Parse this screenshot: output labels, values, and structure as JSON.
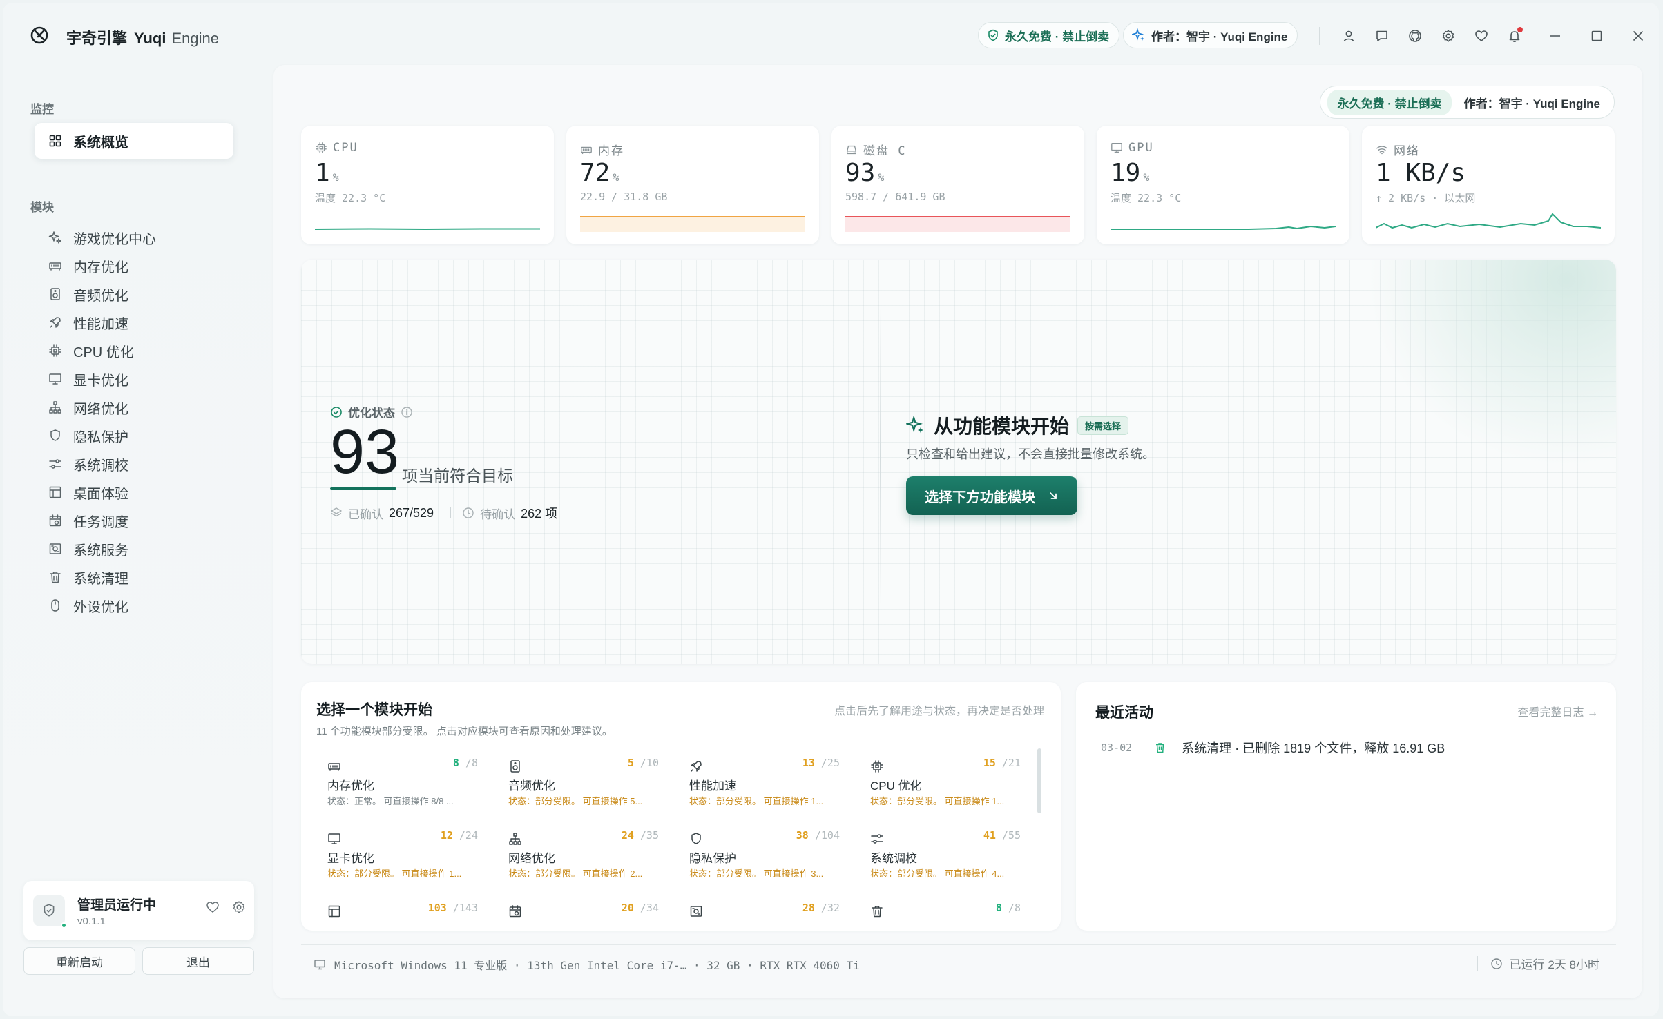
{
  "app": {
    "title_cn": "宇奇引擎",
    "title_en": "Yuqi",
    "title_en2": "Engine"
  },
  "titlebar": {
    "free_pill": "永久免费 · 禁止倒卖",
    "author_pill": "作者：智宇 · Yuqi Engine",
    "icons": [
      "user-icon",
      "message-icon",
      "github-icon",
      "settings-icon",
      "heart-icon",
      "bell-icon"
    ],
    "window_controls": [
      "minimize-icon",
      "maximize-icon",
      "close-icon"
    ]
  },
  "sidebar": {
    "section_monitor": "监控",
    "overview": "系统概览",
    "section_modules": "模块",
    "items": [
      {
        "label": "游戏优化中心",
        "icon": "sparkle-icon"
      },
      {
        "label": "内存优化",
        "icon": "memory-icon"
      },
      {
        "label": "音频优化",
        "icon": "speaker-icon"
      },
      {
        "label": "性能加速",
        "icon": "rocket-icon"
      },
      {
        "label": "CPU 优化",
        "icon": "cpu-icon"
      },
      {
        "label": "显卡优化",
        "icon": "monitor-icon"
      },
      {
        "label": "网络优化",
        "icon": "network-icon"
      },
      {
        "label": "隐私保护",
        "icon": "shield-icon"
      },
      {
        "label": "系统调校",
        "icon": "sliders-icon"
      },
      {
        "label": "桌面体验",
        "icon": "layout-icon"
      },
      {
        "label": "任务调度",
        "icon": "calendar-icon"
      },
      {
        "label": "系统服务",
        "icon": "services-icon"
      },
      {
        "label": "系统清理",
        "icon": "trash-icon"
      },
      {
        "label": "外设优化",
        "icon": "mouse-icon"
      }
    ],
    "admin": {
      "title": "管理员运行中",
      "version": "v0.1.1"
    },
    "restart_btn": "重新启动",
    "exit_btn": "退出"
  },
  "main": {
    "free_tag": "永久免费 · 禁止倒卖",
    "author": "作者：智宇 · Yuqi Engine"
  },
  "stats": [
    {
      "label": "CPU",
      "value": "1",
      "unit": "%",
      "sub": "温度 22.3 °C",
      "color": "#2fa985"
    },
    {
      "label": "内存",
      "value": "72",
      "unit": "%",
      "sub": "22.9 / 31.8 GB",
      "color": "#f0a544"
    },
    {
      "label": "磁盘 C",
      "value": "93",
      "unit": "%",
      "sub": "598.7 / 641.9 GB",
      "color": "#e8555a"
    },
    {
      "label": "GPU",
      "value": "19",
      "unit": "%",
      "sub": "温度 22.3 °C",
      "color": "#2fa985"
    },
    {
      "label": "网络",
      "value": "1 KB/s",
      "unit": "",
      "sub": "↑ 2 KB/s · 以太网",
      "color": "#2fa985"
    }
  ],
  "hero": {
    "status_label": "优化状态",
    "score": "93",
    "score_text": "项当前符合目标",
    "confirmed_label": "已确认",
    "confirmed_value": "267/529",
    "pending_label": "待确认",
    "pending_value": "262 项",
    "right_title": "从功能模块开始",
    "right_badge": "按需选择",
    "right_desc": "只检查和给出建议，不会直接批量修改系统。",
    "button": "选择下方功能模块"
  },
  "modules": {
    "title": "选择一个模块开始",
    "hint": "点击后先了解用途与状态，再决定是否处理",
    "subtitle": "11 个功能模块部分受限。 点击对应模块可查看原因和处理建议。",
    "items": [
      {
        "name": "内存优化",
        "icon": "memory-icon",
        "done": "8",
        "total": "/8",
        "state": "状态：正常。 可直接操作 8/8 ...",
        "ok": true
      },
      {
        "name": "音频优化",
        "icon": "speaker-icon",
        "done": "5",
        "total": "/10",
        "state": "状态：部分受限。 可直接操作 5...",
        "ok": false
      },
      {
        "name": "性能加速",
        "icon": "rocket-icon",
        "done": "13",
        "total": "/25",
        "state": "状态：部分受限。 可直接操作 1...",
        "ok": false
      },
      {
        "name": "CPU 优化",
        "icon": "cpu-icon",
        "done": "15",
        "total": "/21",
        "state": "状态：部分受限。 可直接操作 1...",
        "ok": false
      },
      {
        "name": "显卡优化",
        "icon": "monitor-icon",
        "done": "12",
        "total": "/24",
        "state": "状态：部分受限。 可直接操作 1...",
        "ok": false
      },
      {
        "name": "网络优化",
        "icon": "network-icon",
        "done": "24",
        "total": "/35",
        "state": "状态：部分受限。 可直接操作 2...",
        "ok": false
      },
      {
        "name": "隐私保护",
        "icon": "shield-icon",
        "done": "38",
        "total": "/104",
        "state": "状态：部分受限。 可直接操作 3...",
        "ok": false
      },
      {
        "name": "系统调校",
        "icon": "sliders-icon",
        "done": "41",
        "total": "/55",
        "state": "状态：部分受限。 可直接操作 4...",
        "ok": false
      },
      {
        "name": "",
        "icon": "layout-icon",
        "done": "103",
        "total": "/143",
        "state": "",
        "ok": false
      },
      {
        "name": "",
        "icon": "calendar-icon",
        "done": "20",
        "total": "/34",
        "state": "",
        "ok": false
      },
      {
        "name": "",
        "icon": "services-icon",
        "done": "28",
        "total": "/32",
        "state": "",
        "ok": false
      },
      {
        "name": "",
        "icon": "trash-icon",
        "done": "8",
        "total": "/8",
        "state": "",
        "ok": true
      }
    ]
  },
  "activity": {
    "title": "最近活动",
    "link": "查看完整日志 →",
    "entries": [
      {
        "date": "03-02",
        "text": "系统清理 · 已删除 1819 个文件，释放 16.91 GB"
      }
    ]
  },
  "footer": {
    "system_info": "Microsoft Windows 11 专业版 · 13th Gen Intel Core i7-… · 32 GB · RTX RTX 4060 Ti",
    "uptime": "已运行  2天  8小时"
  },
  "colors": {
    "accent": "#13725c",
    "ok": "#22b07d",
    "warn": "#e0a020"
  }
}
